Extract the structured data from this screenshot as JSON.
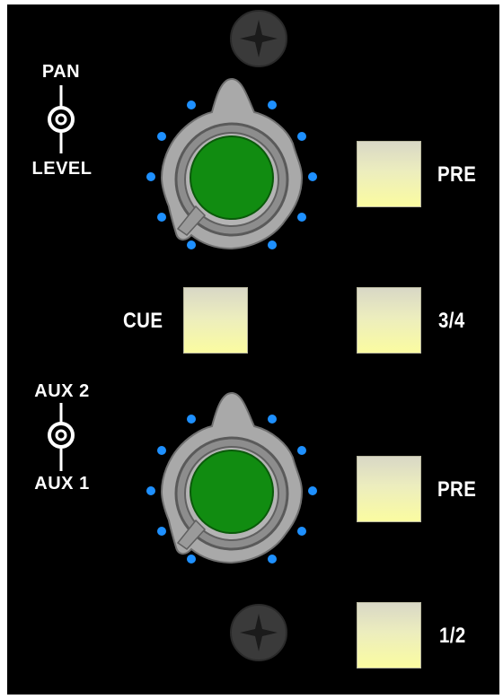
{
  "colors": {
    "panel_bg": "#000000",
    "button_face_top": "#d8d7c6",
    "button_face_bottom": "#fbfca0",
    "knob_cap": "#118c11",
    "knob_body": "#a9a9a9",
    "led_dot": "#1e90ff",
    "label_text": "#ffffff",
    "screw": "#3a3a3a"
  },
  "upper_selector": {
    "top_label": "PAN",
    "bottom_label": "LEVEL",
    "icon": "concentric-selector-icon"
  },
  "lower_selector": {
    "top_label": "AUX 2",
    "bottom_label": "AUX 1",
    "icon": "concentric-selector-icon"
  },
  "knobs": [
    {
      "name": "upper-knob",
      "cap_color": "#118c11",
      "led_count": 10
    },
    {
      "name": "lower-knob",
      "cap_color": "#118c11",
      "led_count": 10
    }
  ],
  "buttons": {
    "pre_upper": "PRE",
    "cue": "CUE",
    "three_four": "3/4",
    "pre_lower": "PRE",
    "one_two": "1/2"
  },
  "screws": {
    "icon": "screw-icon"
  }
}
